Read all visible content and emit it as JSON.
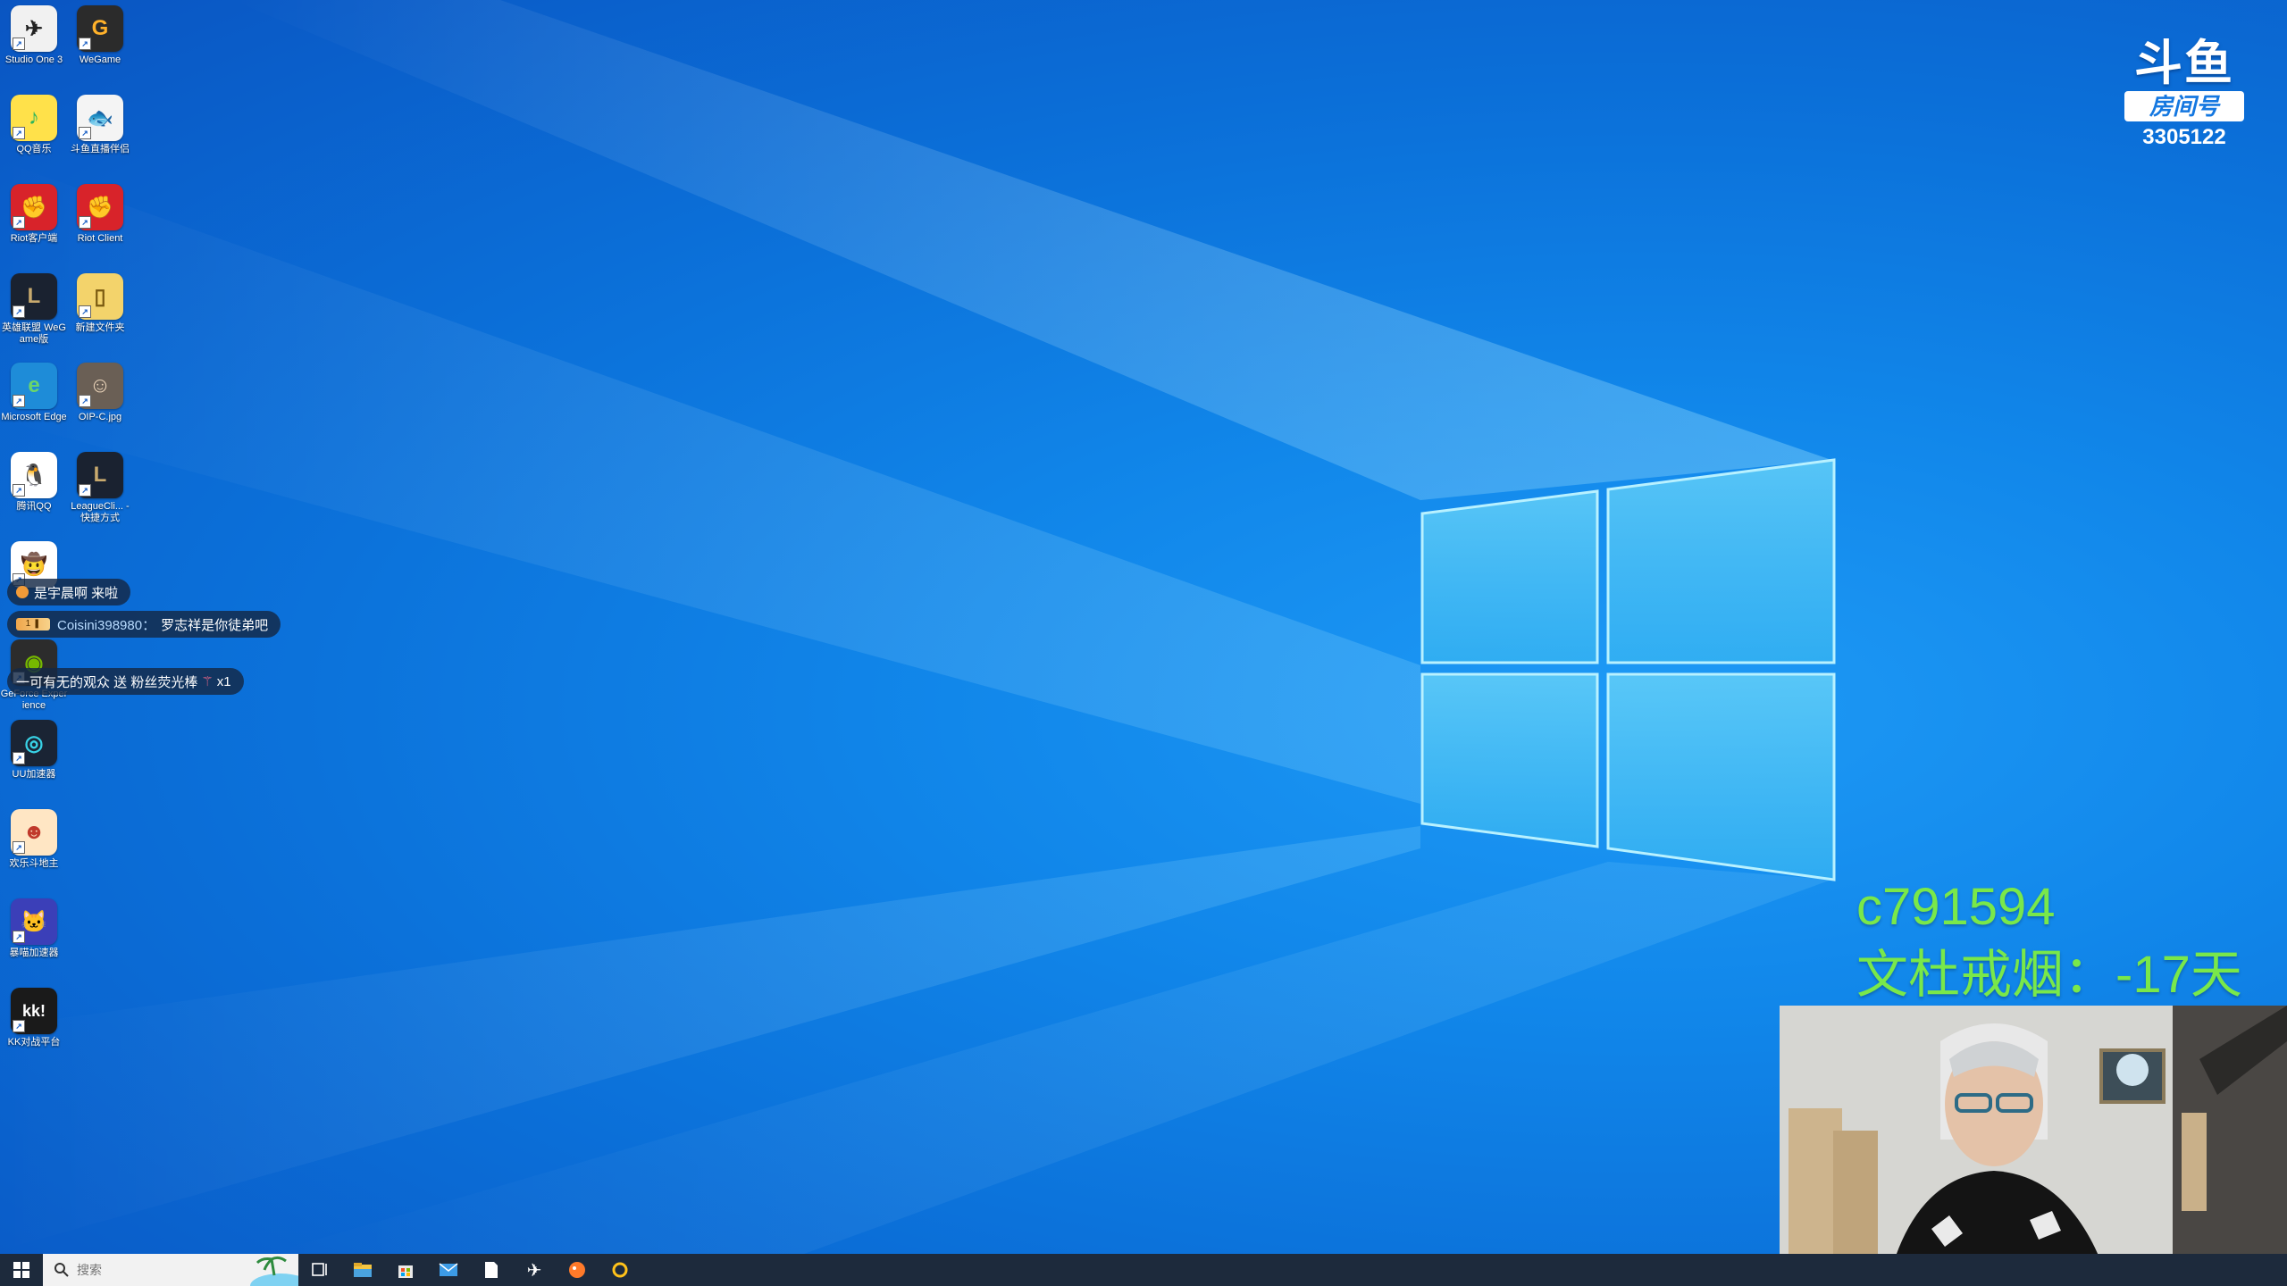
{
  "desktop": {
    "icons": [
      {
        "label": "Studio One 3",
        "icon": "studio-one-icon",
        "color": "#f1f1f1",
        "text": "#222",
        "glyph": "✈"
      },
      {
        "label": "WeGame",
        "icon": "wegame-icon",
        "color": "#2b2b2b",
        "text": "#ffb12a",
        "glyph": "G"
      },
      {
        "label": "QQ音乐",
        "icon": "qq-music-icon",
        "color": "#ffe14a",
        "text": "#2db55d",
        "glyph": "♪"
      },
      {
        "label": "斗鱼直播伴侣",
        "icon": "douyu-companion-icon",
        "color": "#f4f4f4",
        "text": "#ff6a2a",
        "glyph": "🐟"
      },
      {
        "label": "Riot客户端",
        "icon": "riot-client-cn-icon",
        "color": "#d8232a",
        "text": "#fff",
        "glyph": "✊"
      },
      {
        "label": "Riot Client",
        "icon": "riot-client-icon",
        "color": "#d8232a",
        "text": "#fff",
        "glyph": "✊"
      },
      {
        "label": "英雄联盟 WeGame版",
        "icon": "league-wegame-icon",
        "color": "#1a2230",
        "text": "#c8aa6e",
        "glyph": "L"
      },
      {
        "label": "新建文件夹",
        "icon": "new-folder-icon",
        "color": "#f3d36b",
        "text": "#7a5a10",
        "glyph": "▯"
      },
      {
        "label": "Microsoft Edge",
        "icon": "edge-icon",
        "color": "#1e8cd8",
        "text": "#6bd66b",
        "glyph": "e"
      },
      {
        "label": "OIP-C.jpg",
        "icon": "image-file-icon",
        "color": "#6a5f55",
        "text": "#e8d2b8",
        "glyph": "☺"
      },
      {
        "label": "腾讯QQ",
        "icon": "qq-icon",
        "color": "#ffffff",
        "text": "#111",
        "glyph": "🐧"
      },
      {
        "label": "LeagueCli... - 快捷方式",
        "icon": "league-client-icon",
        "color": "#1a2230",
        "text": "#c8aa6e",
        "glyph": "L"
      },
      {
        "label": "",
        "icon": "partial-app-icon",
        "color": "#ffffff",
        "text": "#d33",
        "glyph": "🤠"
      },
      {
        "label": "GeForce Experience",
        "icon": "geforce-icon",
        "color": "#2c2c2c",
        "text": "#76b900",
        "glyph": "◉"
      },
      {
        "label": "UU加速器",
        "icon": "uu-accelerator-icon",
        "color": "#1a2434",
        "text": "#38d2e6",
        "glyph": "◎"
      },
      {
        "label": "欢乐斗地主",
        "icon": "doudizhu-icon",
        "color": "#ffe6c4",
        "text": "#c0392b",
        "glyph": "☻"
      },
      {
        "label": "暴喵加速器",
        "icon": "baomiao-accelerator-icon",
        "color": "#3b3fb8",
        "text": "#fff",
        "glyph": "🐱"
      },
      {
        "label": "KK对战平台",
        "icon": "kk-platform-icon",
        "color": "#1a1a1a",
        "text": "#fff",
        "glyph": "kk!"
      }
    ]
  },
  "chat": {
    "messages": [
      {
        "text": "是宇晨啊 来啦"
      },
      {
        "badge": "⁠1 ❚",
        "user": "Coisini398980：",
        "text": "罗志祥是你徒弟吧"
      },
      {
        "text": "一可有无的观众 送 粉丝荧光棒",
        "count": "x1"
      }
    ]
  },
  "douyu": {
    "brand": "斗鱼",
    "room_label": "房间号",
    "room_number": "3305122"
  },
  "overlay": {
    "line1": "c791594",
    "line2": "文杜戒烟：-17天"
  },
  "taskbar": {
    "search_placeholder": "搜索",
    "pinned": [
      "task-view-icon",
      "file-explorer-icon",
      "store-icon",
      "mail-icon",
      "document-icon",
      "studio-one-icon",
      "douyu-companion-icon",
      "wegame-icon"
    ]
  },
  "colors": {
    "overlay_green": "#79e84a",
    "taskbar": "#1d2a3c",
    "wallpaper_blue": "#1187ea"
  }
}
